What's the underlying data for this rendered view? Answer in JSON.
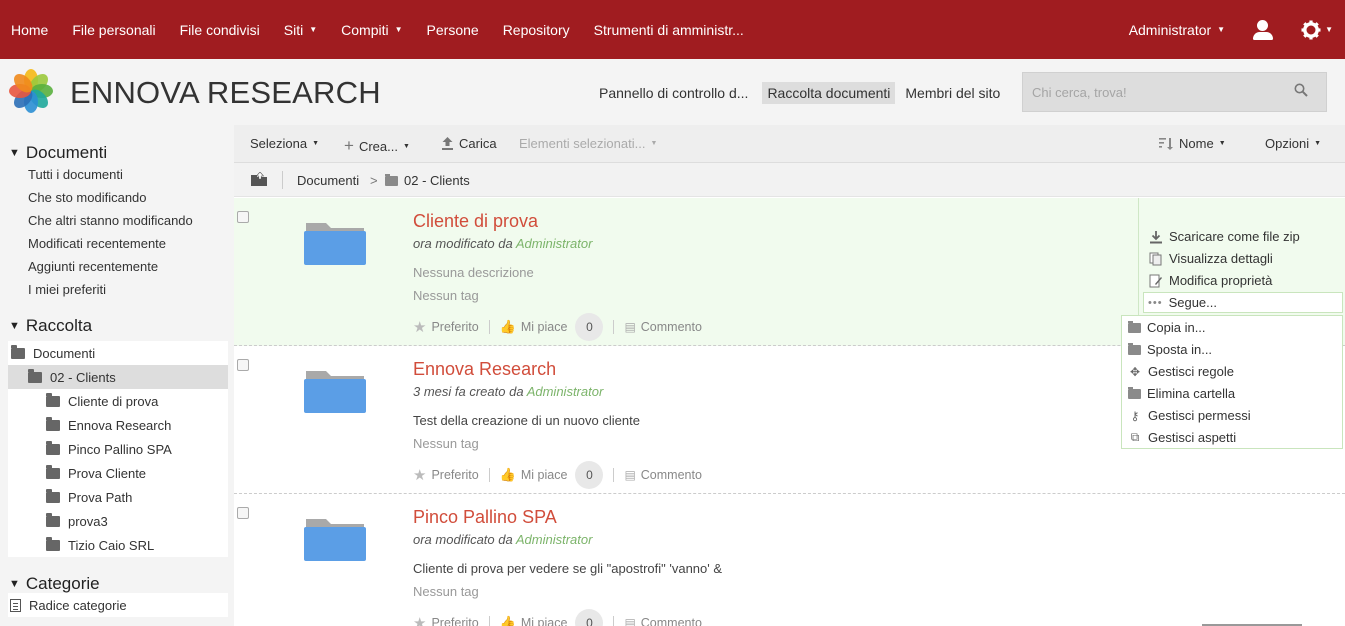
{
  "topnav": {
    "items": [
      {
        "label": "Home",
        "caret": false
      },
      {
        "label": "File personali",
        "caret": false
      },
      {
        "label": "File condivisi",
        "caret": false
      },
      {
        "label": "Siti",
        "caret": true
      },
      {
        "label": "Compiti",
        "caret": true
      },
      {
        "label": "Persone",
        "caret": false
      },
      {
        "label": "Repository",
        "caret": false
      },
      {
        "label": "Strumenti di amministr...",
        "caret": false
      }
    ],
    "user": "Administrator",
    "bg_color": "#a01c20"
  },
  "header": {
    "brand": "ENNOVA RESEARCH",
    "site_nav": [
      "Pannello di controllo d...",
      "Raccolta documenti",
      "Membri del sito"
    ],
    "active_site_nav": "Raccolta documenti",
    "search_placeholder": "Chi cerca, trova!"
  },
  "sidebar": {
    "documenti_title": "Documenti",
    "filters": [
      "Tutti i documenti",
      "Che sto modificando",
      "Che altri stanno modificando",
      "Modificati recentemente",
      "Aggiunti recentemente",
      "I miei preferiti"
    ],
    "raccolta_title": "Raccolta",
    "tree_root": "Documenti",
    "tree_selected": "02 - Clients",
    "tree_children": [
      "Cliente di prova",
      "Ennova Research",
      "Pinco Pallino SPA",
      "Prova Cliente",
      "Prova Path",
      "prova3",
      "Tizio Caio SRL"
    ],
    "categorie_title": "Categorie",
    "categorie_root": "Radice categorie"
  },
  "toolbar": {
    "select": "Seleziona",
    "create": "Crea...",
    "upload": "Carica",
    "selected_items": "Elementi selezionati...",
    "sort": "Nome",
    "options": "Opzioni"
  },
  "breadcrumb": {
    "root": "Documenti",
    "separator": ">",
    "current": "02 - Clients"
  },
  "documents": [
    {
      "title": "Cliente di prova",
      "meta_prefix": "ora modificato da",
      "meta_user": "Administrator",
      "description": "Nessuna descrizione",
      "description_empty": true,
      "tags": "Nessun tag",
      "favorite": "Preferito",
      "like": "Mi piace",
      "like_count": "0",
      "comment": "Commento"
    },
    {
      "title": "Ennova Research",
      "meta_prefix": "3 mesi fa creato da",
      "meta_user": "Administrator",
      "description": "Test della creazione di un nuovo cliente",
      "description_empty": false,
      "tags": "Nessun tag",
      "favorite": "Preferito",
      "like": "Mi piace",
      "like_count": "0",
      "comment": "Commento"
    },
    {
      "title": "Pinco Pallino SPA",
      "meta_prefix": "ora modificato da",
      "meta_user": "Administrator",
      "description": "Cliente di prova per vedere se gli \"apostrofi\" 'vanno' &",
      "description_empty": false,
      "tags": "Nessun tag",
      "favorite": "Preferito",
      "like": "Mi piace",
      "like_count": "0",
      "comment": "Commento"
    }
  ],
  "row_actions": {
    "download_zip": "Scaricare come file zip",
    "view_details": "Visualizza dettagli",
    "edit_props": "Modifica proprietà",
    "more": "Segue...",
    "more_menu": [
      "Copia in...",
      "Sposta in...",
      "Gestisci regole",
      "Elimina cartella",
      "Gestisci permessi",
      "Gestisci aspetti"
    ]
  },
  "colors": {
    "title_red": "#d14d3b",
    "user_green": "#7cb46a",
    "folder_blue": "#5b9ee6"
  }
}
